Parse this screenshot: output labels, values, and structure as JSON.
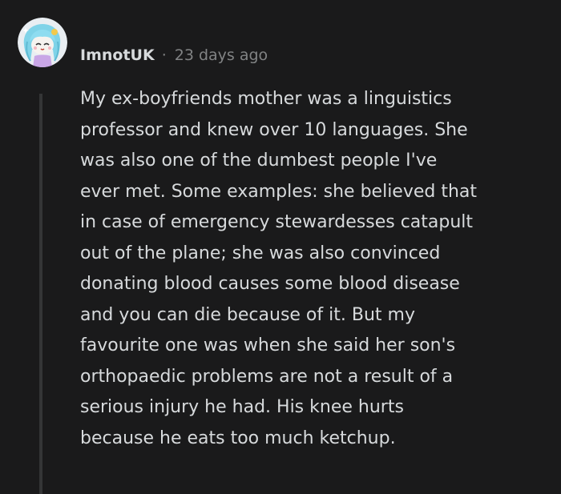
{
  "comment": {
    "author": "ImnotUK",
    "separator": "·",
    "timestamp": "23 days ago",
    "avatar_icon": "snoo-avatar-icon",
    "body_lines": [
      "My ex-boyfriends mother was a linguistics",
      "professor and knew over 10 languages. She",
      "was also one of the dumbest people I've",
      "ever met. Some examples: she believed that",
      "in case of emergency stewardesses catapult",
      "out of the plane; she was also convinced",
      "donating blood causes some blood disease",
      "and you can die because of it. But my",
      "favourite one was when she said her son's",
      "orthopaedic problems are not a result of a",
      "serious injury he had. His knee hurts",
      "because he eats too much ketchup."
    ]
  },
  "colors": {
    "background": "#1a1a1b",
    "text": "#d7dadc",
    "meta": "#818384",
    "thread_line": "#343536",
    "avatar_hair": "#7fd3e8",
    "avatar_bg": "#e9eef2"
  }
}
